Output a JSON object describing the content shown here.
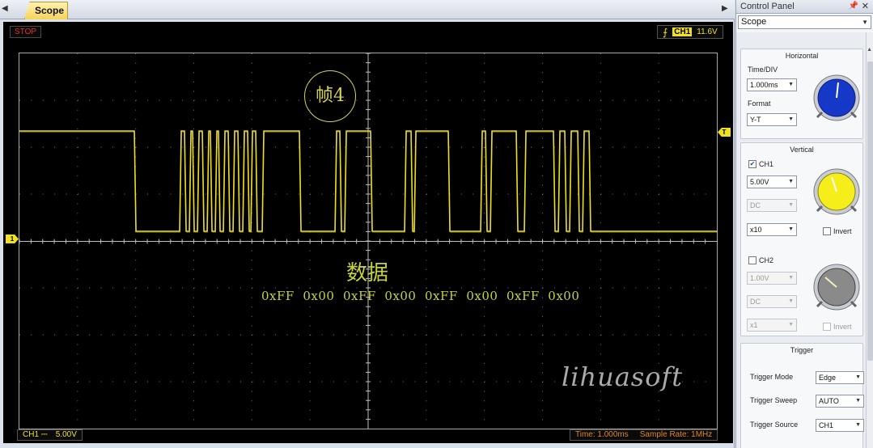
{
  "tabs": [
    {
      "label": "Scope"
    }
  ],
  "scope": {
    "status": "STOP",
    "trigger_channel": "CH1",
    "trigger_level": "11.6V",
    "ch1_marker": "1",
    "trigger_marker": "T",
    "frame_label": "帧4",
    "data_title": "数据",
    "data_bytes": "0xFF  0x00  0xFF  0x00  0xFF  0x00  0xFF  0x00",
    "watermark": "lihuasoft",
    "bottom_channel": "CH1",
    "bottom_coupling": "⎓",
    "bottom_volts": "5.00V",
    "time_readout": "Time: 1.000ms",
    "sample_rate": "Sample Rate: 1MHz",
    "trace_color": "#f0e020",
    "grid_color": "#7a7a7a"
  },
  "control_panel": {
    "title": "Control Panel",
    "pin_icon": "pin-icon",
    "close_icon": "close-icon",
    "mode": "Scope",
    "horizontal": {
      "title": "Horizontal",
      "time_div_label": "Time/DIV",
      "time_div_value": "1.000ms",
      "format_label": "Format",
      "format_value": "Y-T",
      "knob_color": "#1538c8"
    },
    "vertical": {
      "title": "Vertical",
      "ch1_label": "CH1",
      "ch1_checked": true,
      "ch1_volts": "5.00V",
      "ch1_coupling": "DC",
      "ch1_probe": "x10",
      "ch1_invert_label": "Invert",
      "ch1_knob_color": "#f5ee1a",
      "ch2_label": "CH2",
      "ch2_checked": false,
      "ch2_volts": "1.00V",
      "ch2_coupling": "DC",
      "ch2_probe": "x1",
      "ch2_invert_label": "Invert",
      "ch2_knob_color": "#8a8a8a"
    },
    "trigger": {
      "title": "Trigger",
      "mode_label": "Trigger Mode",
      "mode_value": "Edge",
      "sweep_label": "Trigger Sweep",
      "sweep_value": "AUTO",
      "source_label": "Trigger Source",
      "source_value": "CH1"
    }
  }
}
